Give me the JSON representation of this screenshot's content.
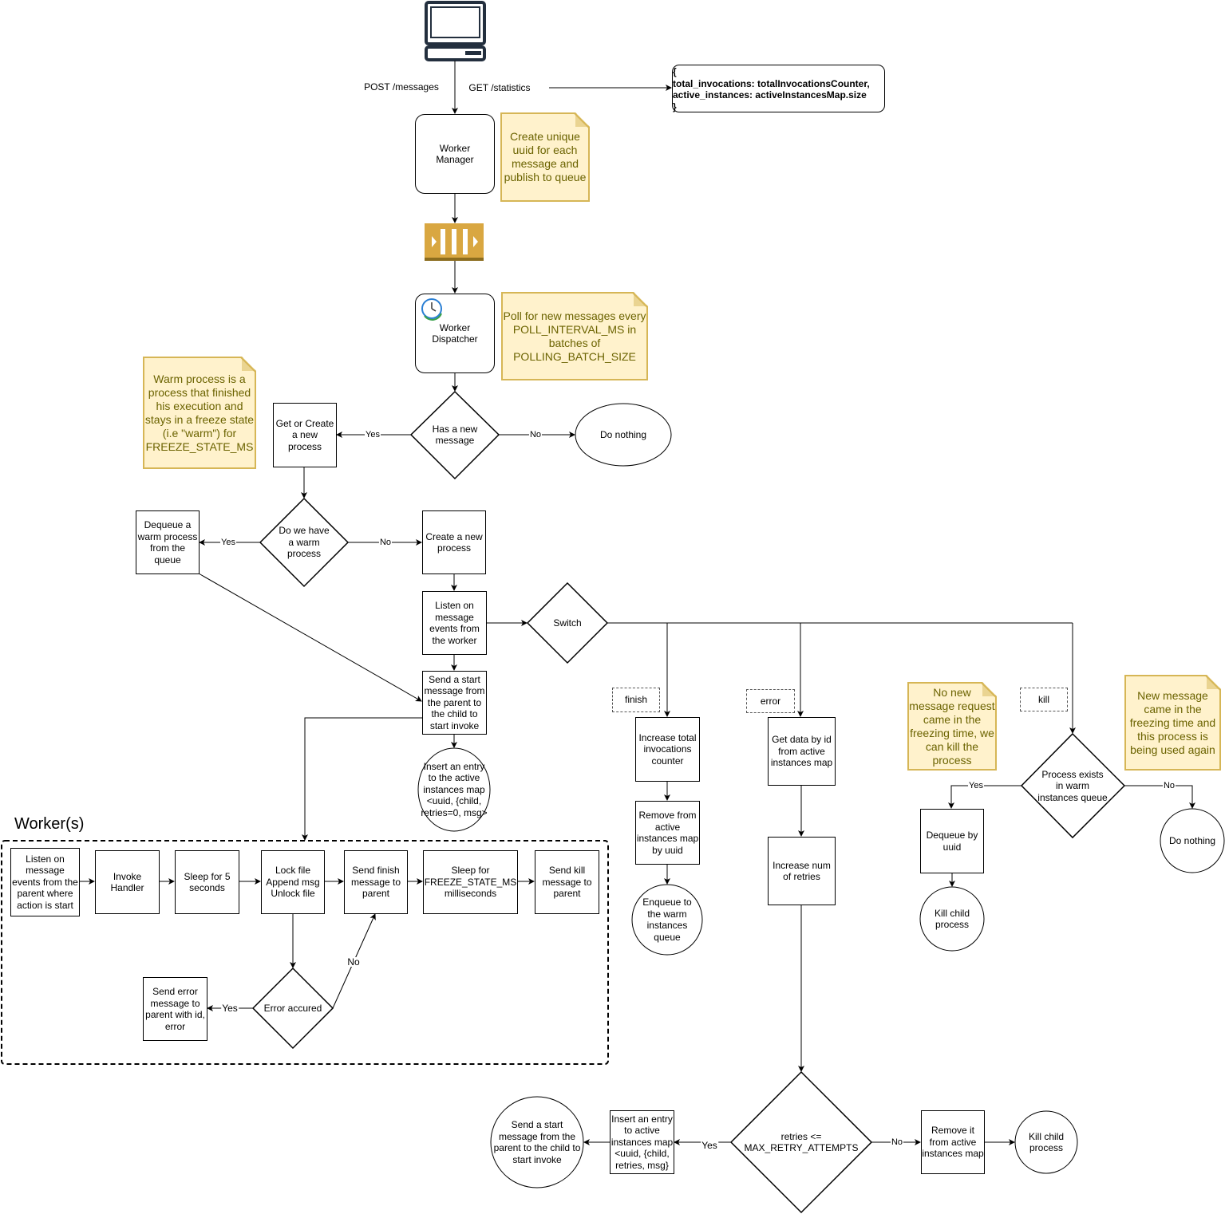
{
  "client": {
    "icon": "computer-icon",
    "post_label": "POST /messages",
    "get_label": "GET /statistics"
  },
  "stats_response": "{\ntotal_invocations: totalInvocationsCounter,\nactive_instances: activeInstancesMap.size\n}",
  "worker_manager": "Worker\nManager",
  "queue_icon": "message-queue-icon",
  "worker_dispatcher": {
    "label": "Worker\nDispatcher",
    "icon": "clock-icon"
  },
  "notes": {
    "uuid": "Create unique uuid for each message and publish to queue",
    "poll": "Poll for new messages every POLL_INTERVAL_MS in batches of POLLING_BATCH_SIZE",
    "warm": "Warm process is a process that finished his execution and stays in a freeze state (i.e \"warm\") for FREEZE_STATE_MS",
    "kill": "No new message request came in the freezing time, we can kill the process",
    "reuse": "New message came in the freezing time and this process is being used again"
  },
  "dispatch": {
    "has_new_message": "Has a new\nmessage",
    "do_nothing": "Do nothing",
    "get_or_create": "Get or Create\na new\nprocess",
    "have_warm": "Do we have\na warm\nprocess",
    "dequeue_warm": "Dequeue a\nwarm process\nfrom the\nqueue",
    "create_new": "Create a new\nprocess",
    "listen_worker": "Listen on\nmessage\nevents from\nthe worker",
    "switch": "Switch",
    "send_start": "Send a start\nmessage from\nthe parent to\nthe child to\nstart invoke",
    "insert_entry": "Insert an entry\nto the active\ninstances map\n<uuid, {child,\nretries=0, msg>"
  },
  "edge_labels": {
    "yes": "Yes",
    "no": "No"
  },
  "cases": {
    "finish": {
      "label": "finish",
      "increase_counter": "Increase total\ninvocations\ncounter",
      "remove_active": "Remove from\nactive\ninstances map\nby uuid",
      "enqueue_warm": "Enqueue to\nthe warm\ninstances\nqueue"
    },
    "error": {
      "label": "error",
      "get_data": "Get data by id\nfrom active\ninstances map",
      "increase_retries": "Increase num\nof retries",
      "retries_check": "retries <=\nMAX_RETRY_ATTEMPTS",
      "insert_entry": "Insert an entry\nto active\ninstances map\n<uuid, {child,\nretries, msg}",
      "send_start": "Send a start\nmessage from the\nparent to the child to\nstart invoke",
      "remove_it": "Remove it\nfrom active\ninstances map",
      "kill_child": "Kill child\nprocess"
    },
    "kill": {
      "label": "kill",
      "process_exists": "Process exists\nin warm\ninstances queue",
      "dequeue_uuid": "Dequeue by\nuuid",
      "kill_child": "Kill child\nprocess",
      "do_nothing": "Do nothing"
    }
  },
  "workers": {
    "title": "Worker(s)",
    "listen_parent": "Listen on\nmessage\nevents from the\nparent where\naction is start",
    "invoke_handler": "Invoke\nHandler",
    "sleep5": "Sleep for 5\nseconds",
    "lock_file": "Lock file\nAppend msg\nUnlock file",
    "send_finish": "Send finish\nmessage to\nparent",
    "sleep_freeze": "Sleep for\nFREEZE_STATE_MS\nmilliseconds",
    "send_kill": "Send kill\nmessage to\nparent",
    "error_occured": "Error accured",
    "send_error": "Send error\nmessage to\nparent with id,\nerror"
  },
  "colors": {
    "note_fill": "#fff2cc",
    "note_border": "#d6b656",
    "note_text": "#6b6300",
    "queue": "#d9a741",
    "computer": "#232f3e"
  }
}
